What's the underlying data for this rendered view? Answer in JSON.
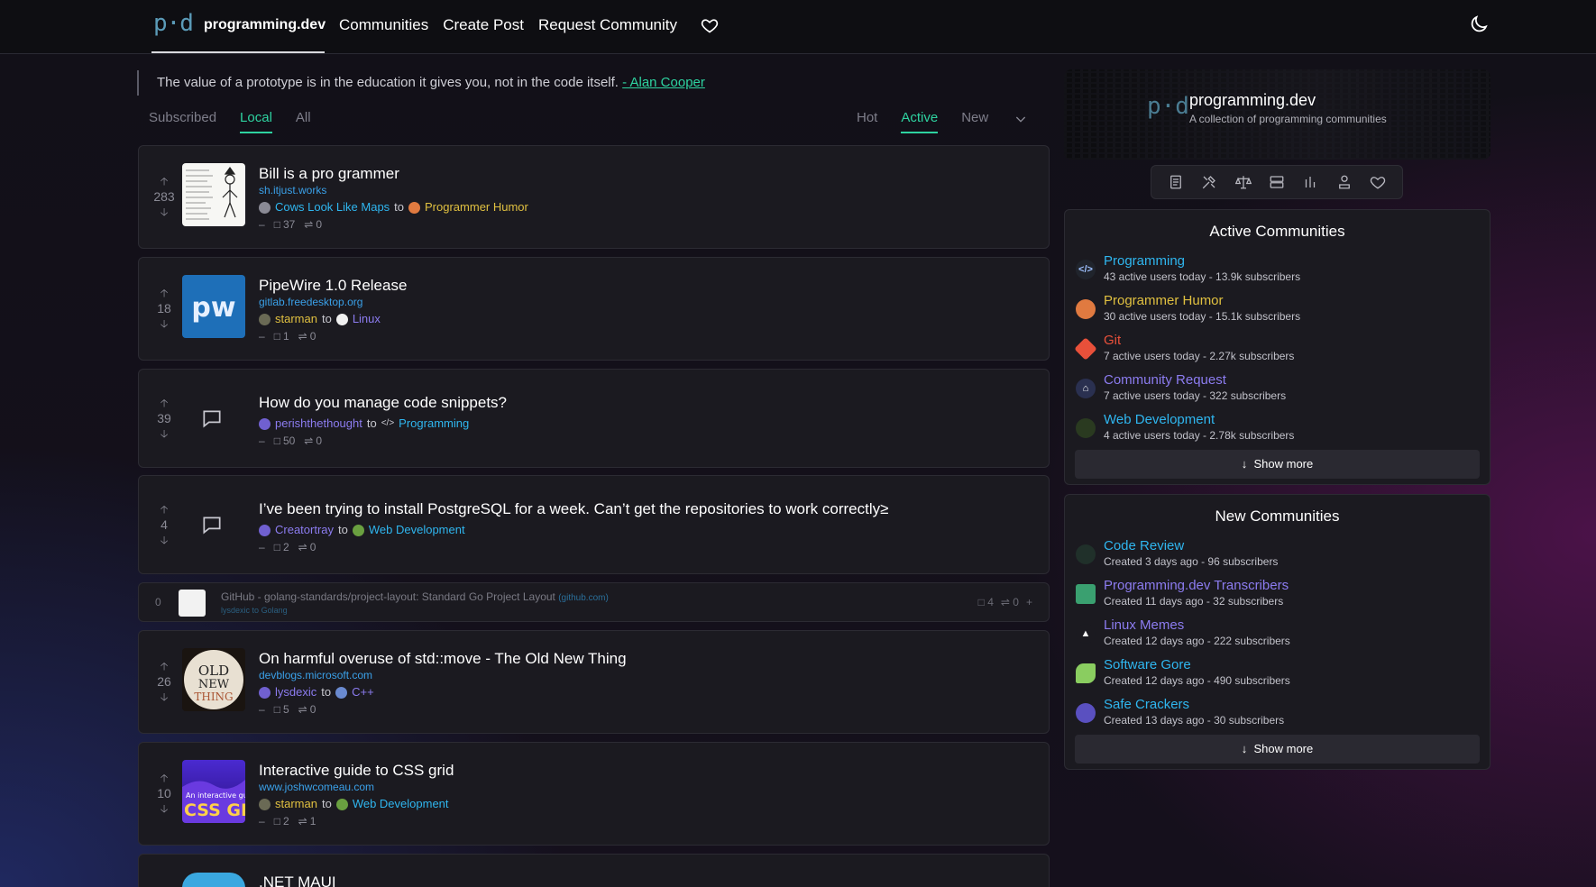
{
  "navbar": {
    "logo": "p·d",
    "site_name": "programming.dev",
    "links": [
      "Communities",
      "Create Post",
      "Request Community"
    ]
  },
  "tagline": {
    "text": "The value of a prototype is in the education it gives you, not in the code itself.",
    "author": "- Alan Cooper"
  },
  "listing_tabs": [
    "Subscribed",
    "Local",
    "All"
  ],
  "listing_active": "Local",
  "sort_tabs": [
    "Hot",
    "Active",
    "New"
  ],
  "sort_active": "Active",
  "posts": [
    {
      "score": "283",
      "title": "Bill is a pro grammer",
      "domain": "sh.itjust.works",
      "user": "Cows Look Like Maps",
      "to": "to",
      "community": "Programmer Humor",
      "comments": "37",
      "crossposts": "0"
    },
    {
      "score": "18",
      "title": "PipeWire 1.0 Release",
      "domain": "gitlab.freedesktop.org",
      "user": "starman",
      "to": "to",
      "community": "Linux",
      "comments": "1",
      "crossposts": "0"
    },
    {
      "score": "39",
      "title": "How do you manage code snippets?",
      "domain": "",
      "user": "perishthethought",
      "to": "to",
      "community": "Programming",
      "comments": "50",
      "crossposts": "0"
    },
    {
      "score": "4",
      "title": "I’ve been trying to install PostgreSQL for a week. Can’t get the repositories to work correctly≥",
      "domain": "",
      "user": "Creatortray",
      "to": "to",
      "community": "Web Development",
      "comments": "2",
      "crossposts": "0"
    },
    {
      "score": "26",
      "title": "On harmful overuse of std::move - The Old New Thing",
      "domain": "devblogs.microsoft.com",
      "user": "lysdexic",
      "to": "to",
      "community": "C++",
      "comments": "5",
      "crossposts": "0"
    },
    {
      "score": "10",
      "title": "Interactive guide to CSS grid",
      "domain": "www.joshwcomeau.com",
      "user": "starman",
      "to": "to",
      "community": "Web Development",
      "comments": "2",
      "crossposts": "1"
    },
    {
      "score": "",
      "title": ".NET MAUI",
      "domain": "",
      "user": "",
      "to": "",
      "community": "",
      "comments": "",
      "crossposts": ""
    }
  ],
  "compact_post": {
    "score": "0",
    "title": "GitHub - golang-standards/project-layout: Standard Go Project Layout",
    "domain": "(github.com)",
    "user": "lysdexic",
    "to": "to",
    "community": "Golang",
    "comments": "4",
    "crossposts": "0",
    "plus": "+"
  },
  "site_banner": {
    "logo": "p·d",
    "name": "programming.dev",
    "description": "A collection of programming communities"
  },
  "active_communities": {
    "title": "Active Communities",
    "items": [
      {
        "name": "Programming",
        "stats": "43 active users today - 13.9k subscribers",
        "color": "#2fb6ef"
      },
      {
        "name": "Programmer Humor",
        "stats": "30 active users today - 15.1k subscribers",
        "color": "#e0a040"
      },
      {
        "name": "Git",
        "stats": "7 active users today - 2.27k subscribers",
        "color": "#e8503a"
      },
      {
        "name": "Community Request",
        "stats": "7 active users today - 322 subscribers",
        "color": "#8c7cf0"
      },
      {
        "name": "Web Development",
        "stats": "4 active users today - 2.78k subscribers",
        "color": "#2fb6ef"
      }
    ],
    "show_more": "Show more"
  },
  "new_communities": {
    "title": "New Communities",
    "items": [
      {
        "name": "Code Review",
        "stats": "Created 3 days ago - 96 subscribers",
        "color": "#2fb6ef"
      },
      {
        "name": "Programming.dev Transcribers",
        "stats": "Created 11 days ago - 32 subscribers",
        "color": "#8c7cf0"
      },
      {
        "name": "Linux Memes",
        "stats": "Created 12 days ago - 222 subscribers",
        "color": "#8c7cf0"
      },
      {
        "name": "Software Gore",
        "stats": "Created 12 days ago - 490 subscribers",
        "color": "#2fb6ef"
      },
      {
        "name": "Safe Crackers",
        "stats": "Created 13 days ago - 30 subscribers",
        "color": "#2fb6ef"
      }
    ],
    "show_more": "Show more"
  },
  "colors": {
    "accent": "#2ed3a0",
    "link": "#2fb6ef",
    "card_bg": "#1b1a20"
  }
}
